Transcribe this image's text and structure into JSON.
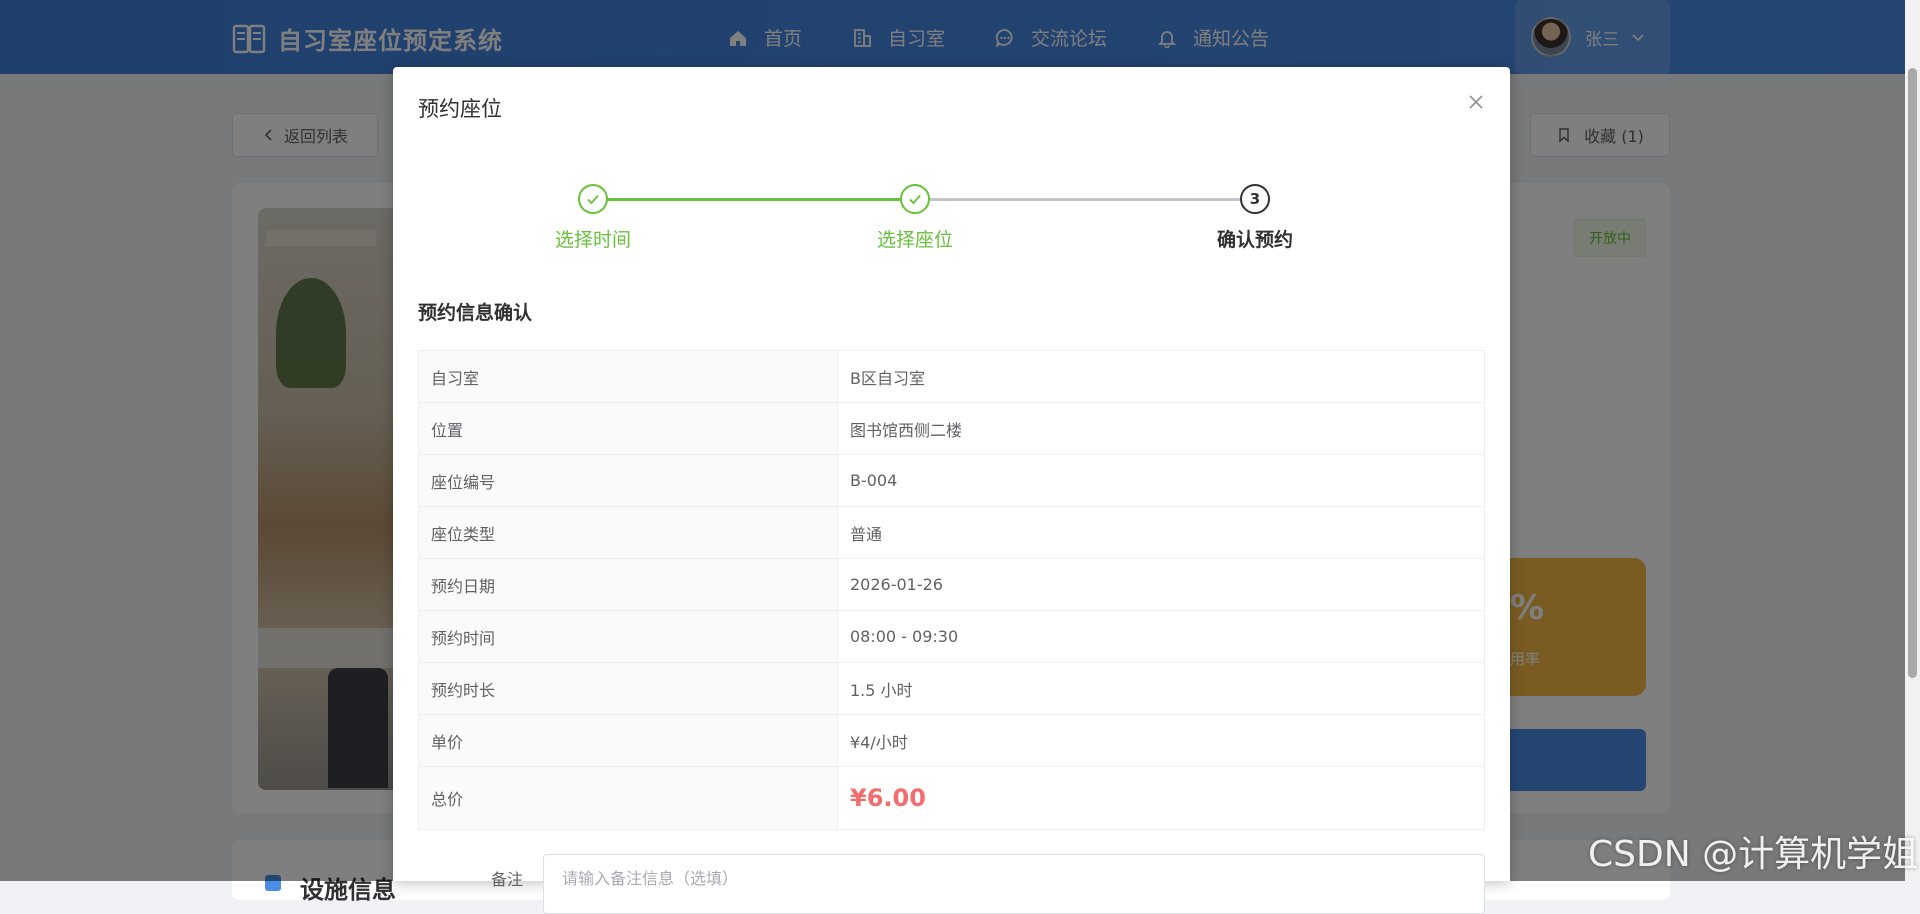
{
  "app": {
    "title": "自习室座位预定系统",
    "nav": [
      {
        "label": "首页",
        "icon": "home-icon"
      },
      {
        "label": "自习室",
        "icon": "building-icon"
      },
      {
        "label": "交流论坛",
        "icon": "chat-icon"
      },
      {
        "label": "通知公告",
        "icon": "bell-icon"
      }
    ],
    "user": {
      "name": "张三"
    }
  },
  "background": {
    "back_label": "返回列表",
    "favorite_label": "收藏 (1)",
    "status_tag": "开放中",
    "stat_value": "%",
    "stat_label": "用率",
    "section_title": "设施信息"
  },
  "dialog": {
    "title": "预约座位",
    "steps": [
      {
        "label": "选择时间",
        "state": "done"
      },
      {
        "label": "选择座位",
        "state": "done"
      },
      {
        "label": "确认预约",
        "state": "active",
        "number": "3"
      }
    ],
    "section_title": "预约信息确认",
    "rows": [
      {
        "key": "自习室",
        "value": "B区自习室"
      },
      {
        "key": "位置",
        "value": "图书馆西侧二楼"
      },
      {
        "key": "座位编号",
        "value": "B-004"
      },
      {
        "key": "座位类型",
        "value": "普通"
      },
      {
        "key": "预约日期",
        "value": "2026-01-26"
      },
      {
        "key": "预约时间",
        "value": "08:00 - 09:30"
      },
      {
        "key": "预约时长",
        "value": "1.5 小时"
      },
      {
        "key": "单价",
        "value": "¥4/小时"
      }
    ],
    "total": {
      "key": "总价",
      "value": "¥6.00"
    },
    "remark": {
      "label": "备注",
      "placeholder": "请输入备注信息（选填）"
    }
  },
  "watermark": "CSDN @计算机学姐",
  "colors": {
    "primary": "#4a8de6",
    "success": "#67c23a",
    "danger": "#f56c6c",
    "warning": "#f5b945"
  }
}
